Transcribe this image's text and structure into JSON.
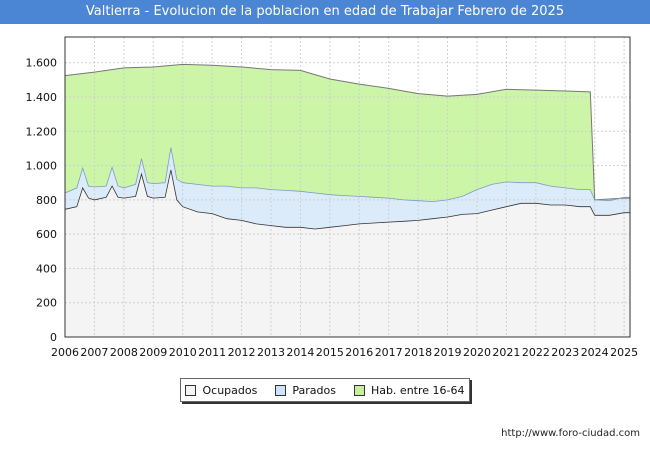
{
  "title": "Valtierra - Evolucion de la poblacion en edad de Trabajar Febrero de 2025",
  "footer_url": "http://www.foro-ciudad.com",
  "colors": {
    "hab": "#ccf5a8",
    "hab_line": "#6a6a6a",
    "parados": "#dcebfa",
    "ocupados": "#f4f4f4",
    "title_bg": "#4a86d4"
  },
  "legend": [
    {
      "label": "Ocupados",
      "color": "#f4f4f4"
    },
    {
      "label": "Parados",
      "color": "#cfe2fa"
    },
    {
      "label": "Hab. entre 16-64",
      "color": "#c6f0a0"
    }
  ],
  "chart_data": {
    "type": "area",
    "title": "Valtierra - Evolucion de la poblacion en edad de Trabajar Febrero de 2025",
    "xlim": [
      2006,
      2025.2
    ],
    "ylim": [
      0,
      1750
    ],
    "x_ticks": [
      "2006",
      "2007",
      "2008",
      "2009",
      "2010",
      "2011",
      "2012",
      "2013",
      "2014",
      "2015",
      "2016",
      "2017",
      "2018",
      "2019",
      "2020",
      "2021",
      "2022",
      "2023",
      "2024",
      "2025"
    ],
    "y_ticks": [
      0,
      200,
      400,
      600,
      800,
      1000,
      1200,
      1400,
      1600
    ],
    "y_tick_labels": [
      "0",
      "200",
      "400",
      "600",
      "800",
      "1.000",
      "1.200",
      "1.400",
      "1.600"
    ],
    "grid": true,
    "legend_position": "bottom",
    "series": [
      {
        "name": "Hab. entre 16-64",
        "points": [
          [
            2006,
            1525
          ],
          [
            2007,
            1545
          ],
          [
            2008,
            1570
          ],
          [
            2009,
            1575
          ],
          [
            2010,
            1590
          ],
          [
            2011,
            1585
          ],
          [
            2012,
            1575
          ],
          [
            2013,
            1560
          ],
          [
            2014,
            1555
          ],
          [
            2015,
            1505
          ],
          [
            2016,
            1475
          ],
          [
            2017,
            1450
          ],
          [
            2018,
            1420
          ],
          [
            2019,
            1405
          ],
          [
            2020,
            1415
          ],
          [
            2021,
            1445
          ],
          [
            2022,
            1440
          ],
          [
            2023,
            1435
          ],
          [
            2023.85,
            1430
          ],
          [
            2024,
            800
          ],
          [
            2025,
            810
          ],
          [
            2025.2,
            810
          ]
        ]
      },
      {
        "name": "Parados",
        "points": [
          [
            2006,
            840
          ],
          [
            2006.4,
            870
          ],
          [
            2006.6,
            985
          ],
          [
            2006.8,
            880
          ],
          [
            2007,
            875
          ],
          [
            2007.4,
            880
          ],
          [
            2007.6,
            990
          ],
          [
            2007.8,
            880
          ],
          [
            2008,
            870
          ],
          [
            2008.4,
            890
          ],
          [
            2008.6,
            1040
          ],
          [
            2008.8,
            900
          ],
          [
            2009,
            895
          ],
          [
            2009.4,
            900
          ],
          [
            2009.6,
            1105
          ],
          [
            2009.8,
            920
          ],
          [
            2010,
            900
          ],
          [
            2010.5,
            890
          ],
          [
            2011,
            880
          ],
          [
            2011.5,
            880
          ],
          [
            2012,
            870
          ],
          [
            2012.5,
            870
          ],
          [
            2013,
            860
          ],
          [
            2013.5,
            855
          ],
          [
            2014,
            850
          ],
          [
            2014.5,
            840
          ],
          [
            2015,
            830
          ],
          [
            2015.5,
            825
          ],
          [
            2016,
            820
          ],
          [
            2016.5,
            815
          ],
          [
            2017,
            810
          ],
          [
            2017.5,
            800
          ],
          [
            2018,
            795
          ],
          [
            2018.5,
            790
          ],
          [
            2019,
            800
          ],
          [
            2019.5,
            820
          ],
          [
            2020,
            860
          ],
          [
            2020.5,
            890
          ],
          [
            2021,
            905
          ],
          [
            2021.5,
            900
          ],
          [
            2022,
            900
          ],
          [
            2022.5,
            880
          ],
          [
            2023,
            870
          ],
          [
            2023.5,
            860
          ],
          [
            2023.85,
            860
          ],
          [
            2024,
            800
          ],
          [
            2024.5,
            795
          ],
          [
            2025,
            815
          ],
          [
            2025.2,
            815
          ]
        ]
      },
      {
        "name": "Ocupados",
        "points": [
          [
            2006,
            745
          ],
          [
            2006.4,
            760
          ],
          [
            2006.6,
            870
          ],
          [
            2006.8,
            810
          ],
          [
            2007,
            800
          ],
          [
            2007.4,
            815
          ],
          [
            2007.6,
            880
          ],
          [
            2007.8,
            815
          ],
          [
            2008,
            810
          ],
          [
            2008.4,
            820
          ],
          [
            2008.6,
            950
          ],
          [
            2008.8,
            820
          ],
          [
            2009,
            810
          ],
          [
            2009.4,
            815
          ],
          [
            2009.6,
            975
          ],
          [
            2009.8,
            800
          ],
          [
            2010,
            760
          ],
          [
            2010.5,
            730
          ],
          [
            2011,
            720
          ],
          [
            2011.5,
            690
          ],
          [
            2012,
            680
          ],
          [
            2012.5,
            660
          ],
          [
            2013,
            650
          ],
          [
            2013.5,
            640
          ],
          [
            2014,
            640
          ],
          [
            2014.5,
            630
          ],
          [
            2015,
            640
          ],
          [
            2015.5,
            650
          ],
          [
            2016,
            660
          ],
          [
            2016.5,
            665
          ],
          [
            2017,
            670
          ],
          [
            2017.5,
            675
          ],
          [
            2018,
            680
          ],
          [
            2018.5,
            690
          ],
          [
            2019,
            700
          ],
          [
            2019.5,
            715
          ],
          [
            2020,
            720
          ],
          [
            2020.5,
            740
          ],
          [
            2021,
            760
          ],
          [
            2021.5,
            780
          ],
          [
            2022,
            780
          ],
          [
            2022.5,
            770
          ],
          [
            2023,
            770
          ],
          [
            2023.5,
            760
          ],
          [
            2023.85,
            760
          ],
          [
            2024,
            710
          ],
          [
            2024.5,
            710
          ],
          [
            2025,
            725
          ],
          [
            2025.2,
            725
          ]
        ]
      }
    ]
  }
}
